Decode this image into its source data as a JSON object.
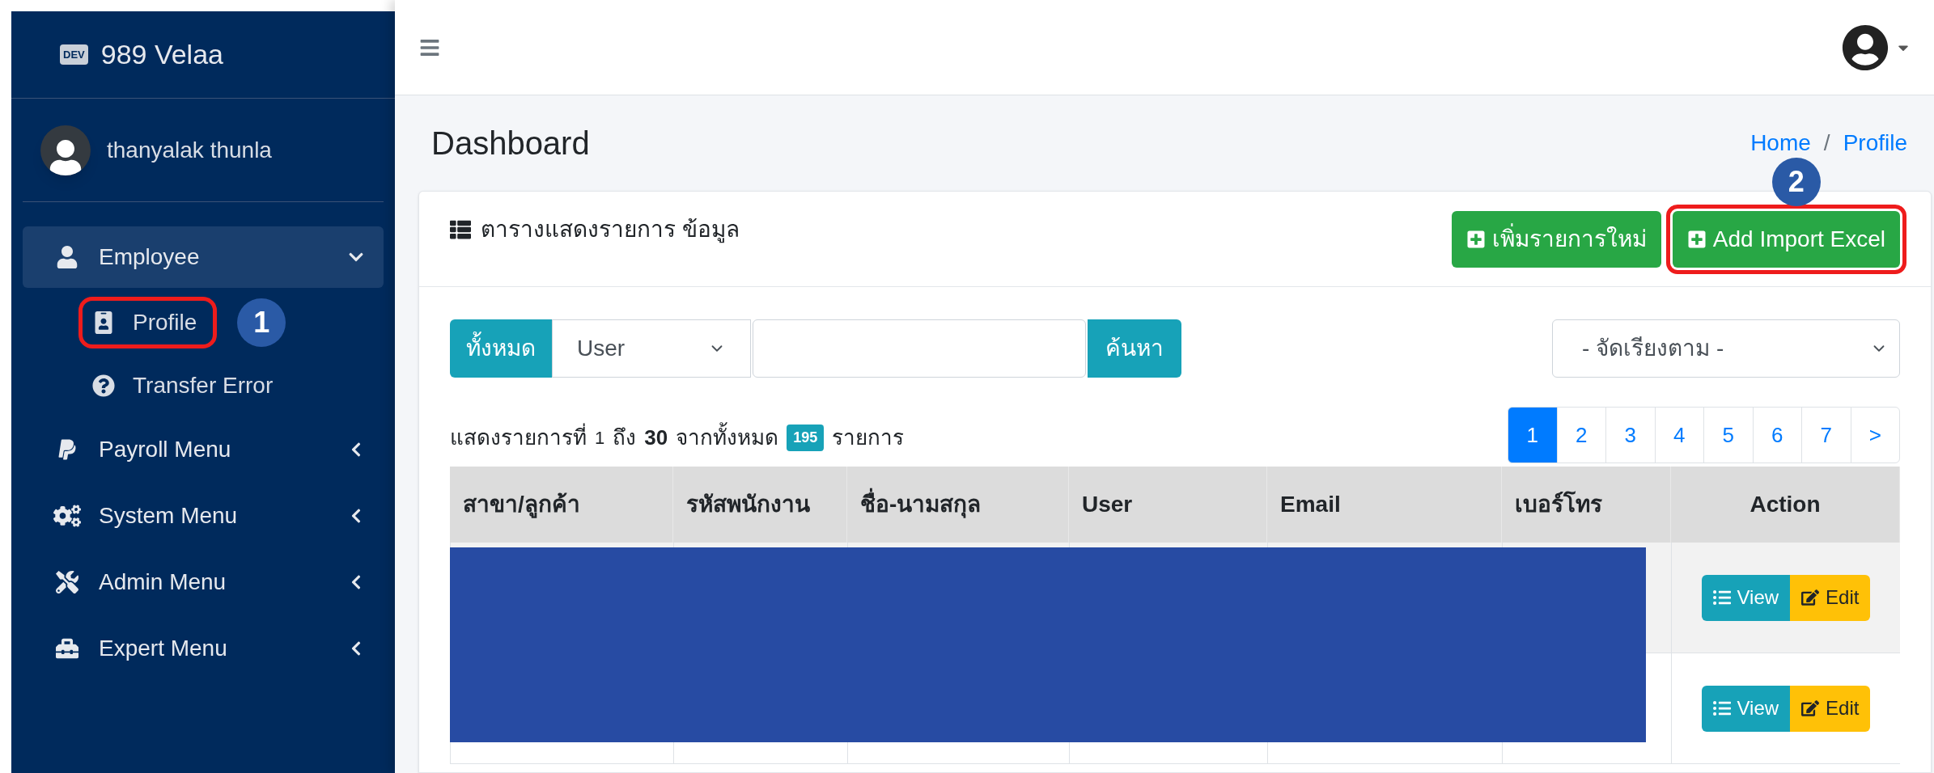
{
  "brand": {
    "badge": "DEV",
    "name": "989 Velaa"
  },
  "user": {
    "name": "thanyalak thunla"
  },
  "menu": [
    {
      "label": "Employee",
      "expanded": true,
      "children": [
        {
          "label": "Profile",
          "callout": "1"
        },
        {
          "label": "Transfer Error"
        }
      ]
    },
    {
      "label": "Payroll Menu",
      "expanded": false
    },
    {
      "label": "System Menu",
      "expanded": false
    },
    {
      "label": "Admin Menu",
      "expanded": false
    },
    {
      "label": "Expert Menu",
      "expanded": false
    }
  ],
  "page_title": "Dashboard",
  "breadcrumb": {
    "items": [
      "Home",
      "Profile"
    ],
    "separator": "/"
  },
  "card": {
    "title": "ตารางแสดงรายการ ข้อมูล",
    "buttons": [
      {
        "label": "เพิ่มรายการใหม่"
      },
      {
        "label": "Add Import Excel",
        "callout": "2"
      }
    ]
  },
  "filter": {
    "all_button": "ทั้งหมด",
    "field_select": "User",
    "search_button": "ค้นหา",
    "sort_select": "- จัดเรียงตาม -"
  },
  "summary": {
    "prefix": "แสดงรายการที่",
    "from": "1",
    "to_word": "ถึง",
    "to": "30",
    "total_word": "จากทั้งหมด",
    "total": "195",
    "suffix": "รายการ"
  },
  "pagination": [
    {
      "label": "1",
      "selected": true
    },
    {
      "label": "2",
      "selected": false
    },
    {
      "label": "3",
      "selected": false
    },
    {
      "label": "4",
      "selected": false
    },
    {
      "label": "5",
      "selected": false
    },
    {
      "label": "6",
      "selected": false
    },
    {
      "label": "7",
      "selected": false
    },
    {
      "label": ">",
      "selected": false
    }
  ],
  "table": {
    "columns": [
      "สาขา/ลูกค้า",
      "รหัสพนักงาน",
      "ชื่อ-นามสกุล",
      "User",
      "Email",
      "เบอร์โทร",
      "Action"
    ],
    "rows": [
      {
        "shaded": true,
        "actions": [
          "View",
          "Edit"
        ]
      },
      {
        "shaded": false,
        "actions": [
          "View",
          "Edit"
        ]
      }
    ]
  }
}
